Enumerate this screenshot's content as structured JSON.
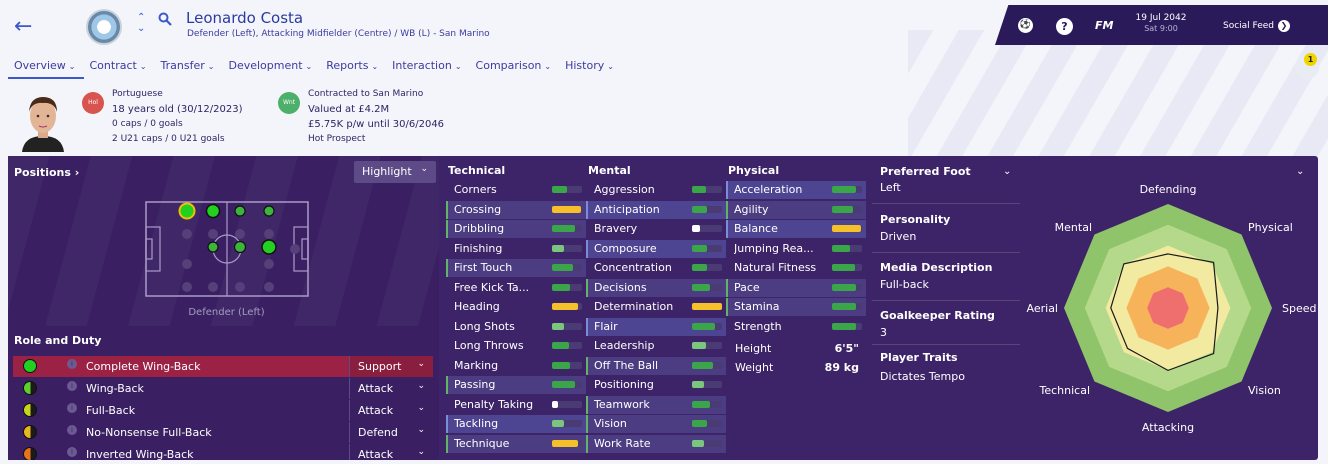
{
  "header": {
    "name": "Leonardo Costa",
    "positions": "Defender (Left), Attacking Midfielder (Centre) / WB (L) - San Marino"
  },
  "tabs": [
    "Overview",
    "Contract",
    "Transfer",
    "Development",
    "Reports",
    "Interaction",
    "Comparison",
    "History"
  ],
  "topbar": {
    "date": "19 Jul 2042",
    "time": "Sat 9:00",
    "social": "Social Feed",
    "logo": "FM",
    "help": "?",
    "notif_count": "1"
  },
  "info": {
    "nationality": "Portuguese",
    "age": "18 years old (30/12/2023)",
    "caps": "0 caps / 0 goals",
    "u21": "2 U21 caps / 0 U21 goals",
    "contract": "Contracted to San Marino",
    "value": "Valued at £4.2M",
    "wage": "£5.75K p/w until 30/6/2046",
    "prospect": "Hot Prospect",
    "hol_badge": "Hol",
    "wnt_badge": "Wnt"
  },
  "positions_panel": {
    "title": "Positions",
    "highlight": "Highlight",
    "selected_label": "Defender (Left)",
    "role_title": "Role and Duty"
  },
  "roles": [
    {
      "name": "Complete Wing-Back",
      "duty": "Support",
      "color": "#22d022",
      "half": false,
      "selected": true
    },
    {
      "name": "Wing-Back",
      "duty": "Attack",
      "color": "#5ed02a",
      "half": true,
      "selected": false
    },
    {
      "name": "Full-Back",
      "duty": "Attack",
      "color": "#c9d51b",
      "half": true,
      "selected": false
    },
    {
      "name": "No-Nonsense Full-Back",
      "duty": "Defend",
      "color": "#e6b81c",
      "half": true,
      "selected": false
    },
    {
      "name": "Inverted Wing-Back",
      "duty": "Attack",
      "color": "#e8741a",
      "half": true,
      "selected": false
    }
  ],
  "technical": {
    "title": "Technical",
    "items": [
      {
        "name": "Corners",
        "v": 0.5,
        "c": "#3aa649",
        "h": 0
      },
      {
        "name": "Crossing",
        "v": 0.95,
        "c": "#f5c02a",
        "h": 1
      },
      {
        "name": "Dribbling",
        "v": 0.75,
        "c": "#3aa649",
        "h": 1
      },
      {
        "name": "Finishing",
        "v": 0.4,
        "c": "#7bc67d",
        "h": 0
      },
      {
        "name": "First Touch",
        "v": 0.7,
        "c": "#3aa649",
        "h": 1
      },
      {
        "name": "Free Kick Ta...",
        "v": 0.6,
        "c": "#3aa649",
        "h": 0
      },
      {
        "name": "Heading",
        "v": 0.85,
        "c": "#f5c02a",
        "h": 0
      },
      {
        "name": "Long Shots",
        "v": 0.4,
        "c": "#7bc67d",
        "h": 0
      },
      {
        "name": "Long Throws",
        "v": 0.55,
        "c": "#3aa649",
        "h": 0
      },
      {
        "name": "Marking",
        "v": 0.6,
        "c": "#3aa649",
        "h": 0
      },
      {
        "name": "Passing",
        "v": 0.75,
        "c": "#3aa649",
        "h": 1
      },
      {
        "name": "Penalty Taking",
        "v": 0.2,
        "c": "#ffffff",
        "h": 0
      },
      {
        "name": "Tackling",
        "v": 0.4,
        "c": "#7bc67d",
        "h": 2
      },
      {
        "name": "Technique",
        "v": 0.85,
        "c": "#f5c02a",
        "h": 1
      }
    ]
  },
  "mental": {
    "title": "Mental",
    "items": [
      {
        "name": "Aggression",
        "v": 0.45,
        "c": "#3aa649",
        "h": 0
      },
      {
        "name": "Anticipation",
        "v": 0.5,
        "c": "#3aa649",
        "h": 2
      },
      {
        "name": "Bravery",
        "v": 0.25,
        "c": "#ffffff",
        "h": 0
      },
      {
        "name": "Composure",
        "v": 0.5,
        "c": "#3aa649",
        "h": 2
      },
      {
        "name": "Concentration",
        "v": 0.5,
        "c": "#3aa649",
        "h": 0
      },
      {
        "name": "Decisions",
        "v": 0.6,
        "c": "#3aa649",
        "h": 1
      },
      {
        "name": "Determination",
        "v": 1.0,
        "c": "#f5c02a",
        "h": 0
      },
      {
        "name": "Flair",
        "v": 0.75,
        "c": "#3aa649",
        "h": 2
      },
      {
        "name": "Leadership",
        "v": 0.45,
        "c": "#7bc67d",
        "h": 0
      },
      {
        "name": "Off The Ball",
        "v": 0.7,
        "c": "#3aa649",
        "h": 1
      },
      {
        "name": "Positioning",
        "v": 0.4,
        "c": "#7bc67d",
        "h": 0
      },
      {
        "name": "Teamwork",
        "v": 0.6,
        "c": "#3aa649",
        "h": 1
      },
      {
        "name": "Vision",
        "v": 0.5,
        "c": "#3aa649",
        "h": 1
      },
      {
        "name": "Work Rate",
        "v": 0.4,
        "c": "#7bc67d",
        "h": 1
      }
    ]
  },
  "physical": {
    "title": "Physical",
    "items": [
      {
        "name": "Acceleration",
        "v": 0.8,
        "c": "#3aa649",
        "h": 2
      },
      {
        "name": "Agility",
        "v": 0.7,
        "c": "#3aa649",
        "h": 1
      },
      {
        "name": "Balance",
        "v": 0.95,
        "c": "#f5c02a",
        "h": 2
      },
      {
        "name": "Jumping Rea...",
        "v": 0.6,
        "c": "#3aa649",
        "h": 0
      },
      {
        "name": "Natural Fitness",
        "v": 0.75,
        "c": "#3aa649",
        "h": 0
      },
      {
        "name": "Pace",
        "v": 0.8,
        "c": "#3aa649",
        "h": 1
      },
      {
        "name": "Stamina",
        "v": 0.8,
        "c": "#3aa649",
        "h": 1
      },
      {
        "name": "Strength",
        "v": 0.8,
        "c": "#3aa649",
        "h": 0
      }
    ],
    "height_label": "Height",
    "height": "6'5\"",
    "weight_label": "Weight",
    "weight": "89 kg"
  },
  "details": {
    "foot_h": "Preferred Foot",
    "foot": "Left",
    "pers_h": "Personality",
    "pers": "Driven",
    "media_h": "Media Description",
    "media": "Full-back",
    "gk_h": "Goalkeeper Rating",
    "gk": "3",
    "traits_h": "Player Traits",
    "traits": "Dictates Tempo"
  },
  "radar": {
    "labels": [
      "Defending",
      "Physical",
      "Speed",
      "Vision",
      "Attacking",
      "Technical",
      "Aerial",
      "Mental"
    ],
    "values": [
      0.52,
      0.62,
      0.48,
      0.62,
      0.6,
      0.55,
      0.55,
      0.6
    ]
  }
}
